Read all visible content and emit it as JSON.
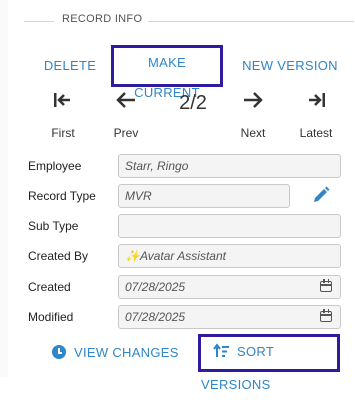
{
  "section": {
    "title": "RECORD INFO"
  },
  "actions": {
    "delete": "DELETE",
    "make_current": "MAKE CURRENT",
    "new_version": "NEW VERSION"
  },
  "navigation": {
    "first_label": "First",
    "prev_label": "Prev",
    "next_label": "Next",
    "latest_label": "Latest",
    "counter": "2/2"
  },
  "fields": {
    "employee": {
      "label": "Employee",
      "value": "Starr, Ringo"
    },
    "record_type": {
      "label": "Record Type",
      "value": "MVR"
    },
    "sub_type": {
      "label": "Sub Type",
      "value": ""
    },
    "created_by": {
      "label": "Created By",
      "value": "✨Avatar Assistant"
    },
    "created": {
      "label": "Created",
      "value": "07/28/2025"
    },
    "modified": {
      "label": "Modified",
      "value": "07/28/2025"
    }
  },
  "footer": {
    "view_changes": "VIEW CHANGES",
    "sort_versions": "SORT VERSIONS"
  },
  "colors": {
    "accent": "#2f86c8",
    "highlight_border": "#2f1aa0"
  }
}
